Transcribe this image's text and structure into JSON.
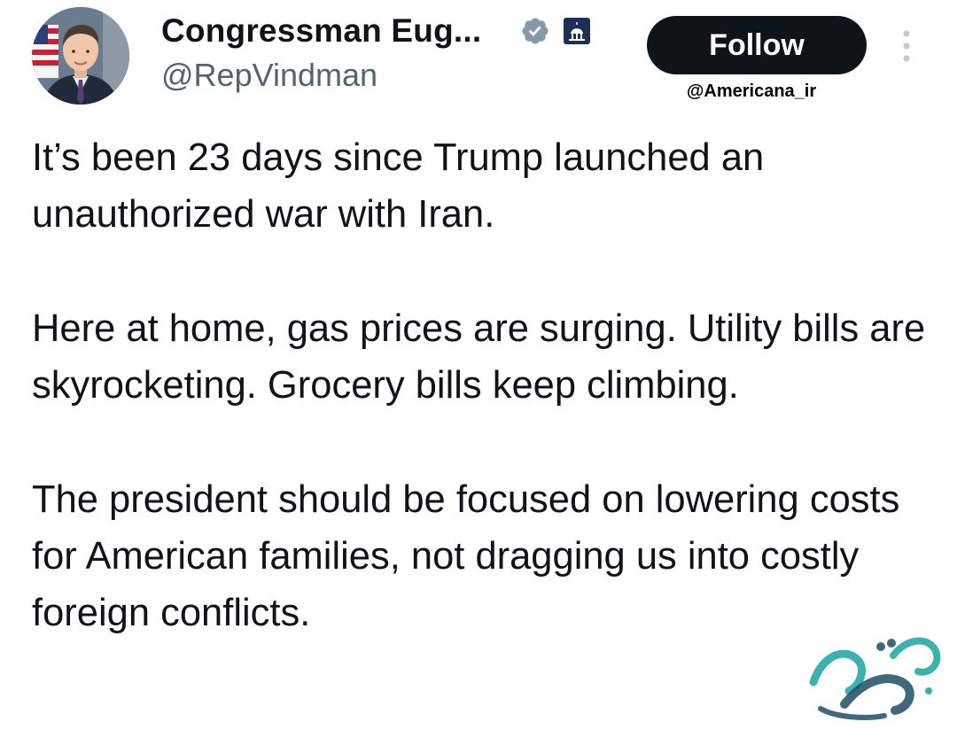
{
  "author": {
    "display_name": "Congressman Eug...",
    "handle": "@RepVindman",
    "verified_icon": "verified-badge-icon",
    "affiliation_icon": "capitol-building-icon",
    "avatar": "profile-photo"
  },
  "actions": {
    "follow_label": "Follow",
    "more_icon": "more-vertical-icon"
  },
  "watermark": {
    "handle": "@Americana_ir",
    "logo": "persian-calligraphy-logo"
  },
  "tweet": {
    "paragraphs": [
      "It’s been 23 days since Trump launched an unauthorized war with Iran.",
      "Here at home, gas prices are surging. Utility bills are skyrocketing. Grocery bills keep climbing.",
      "The president should be focused on lowering costs for American families, not dragging us into costly foreign conflicts."
    ]
  },
  "colors": {
    "text": "#0f1419",
    "secondary_text": "#536471",
    "button_bg": "#0f1419",
    "button_text": "#ffffff",
    "logo_teal": "#1aa5a0",
    "logo_dark": "#1f4d66"
  }
}
